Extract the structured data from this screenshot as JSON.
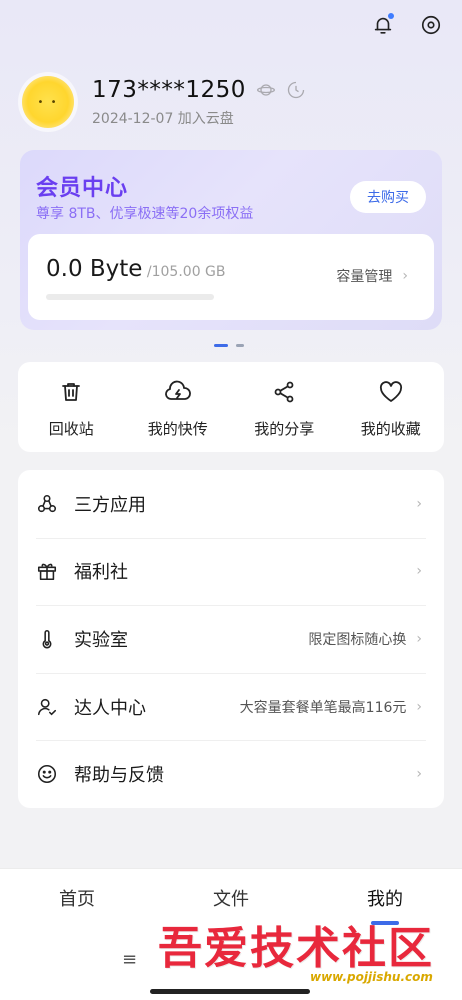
{
  "profile": {
    "phone": "173****1250",
    "join_date": "2024-12-07 加入云盘"
  },
  "member": {
    "title": "会员中心",
    "subtitle": "尊享 8TB、优享极速等20余项权益",
    "buy_label": "去购买"
  },
  "storage": {
    "used": "0.0 Byte",
    "total": " /105.00 GB",
    "manage_label": "容量管理",
    "progress": 0
  },
  "quick_actions": [
    {
      "label": "回收站",
      "icon": "trash-icon"
    },
    {
      "label": "我的快传",
      "icon": "cloud-lightning-icon"
    },
    {
      "label": "我的分享",
      "icon": "share-icon"
    },
    {
      "label": "我的收藏",
      "icon": "heart-icon"
    }
  ],
  "menu": [
    {
      "label": "三方应用",
      "hint": "",
      "icon": "apps-icon"
    },
    {
      "label": "福利社",
      "hint": "",
      "icon": "gift-icon"
    },
    {
      "label": "实验室",
      "hint": "限定图标随心换",
      "icon": "thermometer-icon"
    },
    {
      "label": "达人中心",
      "hint": "大容量套餐单笔最高116元",
      "icon": "user-check-icon"
    },
    {
      "label": "帮助与反馈",
      "hint": "",
      "icon": "smile-icon"
    }
  ],
  "nav": {
    "tabs": [
      "首页",
      "文件",
      "我的"
    ],
    "active": "我的"
  },
  "system": {
    "menu_glyph": "≡"
  },
  "watermark": {
    "title": "吾爱技术社区",
    "url": "www.pojjishu.com"
  },
  "colors": {
    "accent": "#3d6be8",
    "member_purple": "#6a3ff0"
  }
}
